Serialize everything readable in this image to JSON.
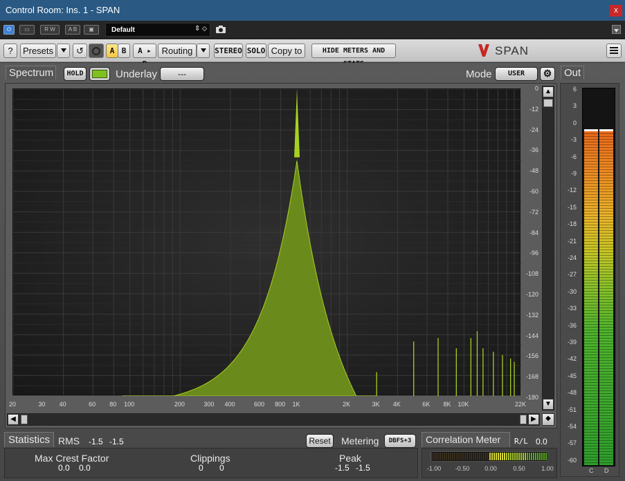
{
  "window": {
    "title": "Control Room: Ins. 1 - SPAN",
    "close": "x"
  },
  "hostbar": {
    "preset_name": "Default",
    "btn_rw": "R W",
    "btn_ab": "A B",
    "btn_mid": "▣"
  },
  "toolbar": {
    "help": "?",
    "presets": "Presets",
    "a": "A",
    "b": "B",
    "a_to_b": "A ▸ B",
    "routing": "Routing",
    "stereo": "STEREO",
    "solo": "SOLO",
    "copy_to": "Copy to",
    "hide_meters": "HIDE METERS AND STATS",
    "brand": "SPAN"
  },
  "spectrum": {
    "label": "Spectrum",
    "hold": "HOLD",
    "underlay_label": "Underlay",
    "underlay_value": "---",
    "mode_label": "Mode",
    "mode_value": "USER",
    "db_ticks": [
      "0",
      "-12",
      "-24",
      "-36",
      "-48",
      "-60",
      "-72",
      "-84",
      "-96",
      "-108",
      "-120",
      "-132",
      "-144",
      "-156",
      "-168",
      "-180"
    ],
    "freq_ticks": [
      "20",
      "30",
      "40",
      "60",
      "80",
      "100",
      "200",
      "300",
      "400",
      "600",
      "800",
      "1K",
      "2K",
      "3K",
      "4K",
      "6K",
      "8K",
      "10K",
      "22K"
    ]
  },
  "statistics": {
    "label": "Statistics",
    "rms_label": "RMS",
    "rms_l": "-1.5",
    "rms_r": "-1.5",
    "reset": "Reset",
    "metering_label": "Metering",
    "metering_value": "DBFS+3",
    "crest_label": "Max Crest Factor",
    "crest_l": "0.0",
    "crest_r": "0.0",
    "clip_label": "Clippings",
    "clip_l": "0",
    "clip_r": "0",
    "peak_label": "Peak",
    "peak_l": "-1.5",
    "peak_r": "-1.5"
  },
  "correlation": {
    "label": "Correlation Meter",
    "rl": "R/L",
    "value": "0.0",
    "ticks": [
      "-1.00",
      "-0.50",
      "0.00",
      "0.50",
      "1.00"
    ]
  },
  "out_meter": {
    "label": "Out",
    "ch_l": "C",
    "ch_r": "D",
    "level_db": -1.5,
    "ticks": [
      "6",
      "3",
      "0",
      "-3",
      "-6",
      "-9",
      "-12",
      "-15",
      "-18",
      "-21",
      "-24",
      "-27",
      "-30",
      "-33",
      "-36",
      "-39",
      "-42",
      "-45",
      "-48",
      "-51",
      "-54",
      "-57",
      "-60"
    ]
  },
  "colors": {
    "accent": "#a8d020",
    "spectrum_fill": "#6a8a1c",
    "titlebar": "#2a5a84"
  }
}
